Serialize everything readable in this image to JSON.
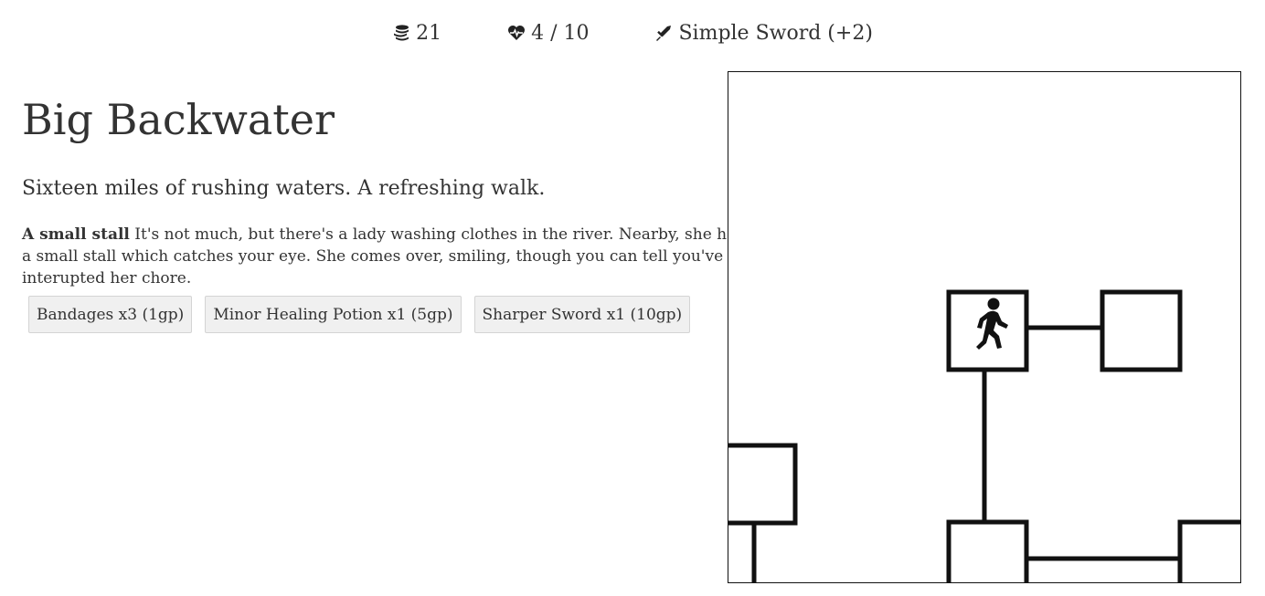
{
  "status": {
    "gold": "21",
    "health": "4 / 10",
    "weapon": "Simple Sword (+2)",
    "icons": {
      "gold": "coins-icon",
      "health": "heart-pulse-icon",
      "weapon": "sword-icon"
    }
  },
  "location": {
    "title": "Big Backwater",
    "description": "Sixteen miles of rushing waters. A refreshing walk."
  },
  "encounter": {
    "heading": "A small stall",
    "text": "It's not much, but there's a lady washing clothes in the river. Nearby, she has a small stall which catches your eye. She comes over, smiling, though you can tell you've interupted her chore."
  },
  "shop": {
    "items": [
      {
        "label": "Bandages x3 (1gp)"
      },
      {
        "label": "Minor Healing Potion x1 (5gp)"
      },
      {
        "label": "Sharper Sword x1 (10gp)"
      }
    ]
  },
  "map": {
    "player_icon": "walking-person-icon",
    "line_color": "#111111"
  }
}
